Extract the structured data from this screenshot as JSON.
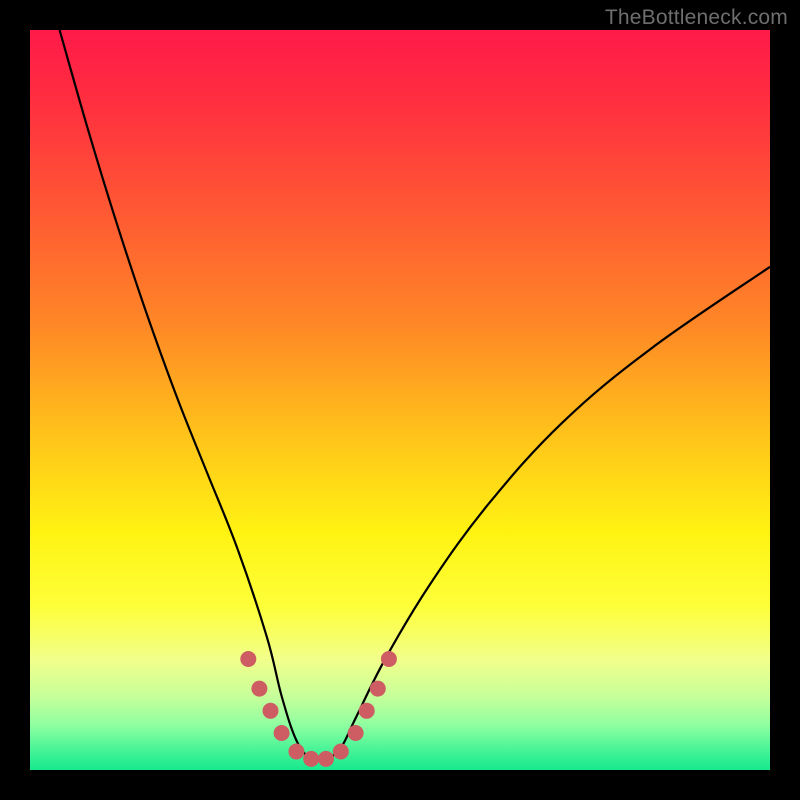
{
  "watermark": "TheBottleneck.com",
  "colors": {
    "black": "#000000",
    "curve": "#000000",
    "marker": "#cd5d63",
    "gradient_stops": [
      {
        "offset": 0.0,
        "color": "#ff1a49"
      },
      {
        "offset": 0.1,
        "color": "#ff2f3f"
      },
      {
        "offset": 0.25,
        "color": "#ff5a33"
      },
      {
        "offset": 0.4,
        "color": "#ff8826"
      },
      {
        "offset": 0.55,
        "color": "#ffc41a"
      },
      {
        "offset": 0.68,
        "color": "#fff312"
      },
      {
        "offset": 0.78,
        "color": "#fdff3a"
      },
      {
        "offset": 0.85,
        "color": "#f2ff8a"
      },
      {
        "offset": 0.9,
        "color": "#c7ff9a"
      },
      {
        "offset": 0.94,
        "color": "#8effa0"
      },
      {
        "offset": 0.97,
        "color": "#4cf598"
      },
      {
        "offset": 1.0,
        "color": "#17e88e"
      }
    ]
  },
  "chart_data": {
    "type": "line",
    "title": "",
    "xlabel": "",
    "ylabel": "",
    "xlim": [
      0,
      100
    ],
    "ylim": [
      0,
      100
    ],
    "note": "V-shaped bottleneck curve. y≈0 is optimal (green), y≈100 is worst (red). Minimum sits near x≈38 with a flat bottom ~x∈[34,44].",
    "series": [
      {
        "name": "bottleneck-curve",
        "x": [
          4,
          8,
          12,
          16,
          20,
          24,
          28,
          32,
          34,
          36,
          38,
          40,
          42,
          44,
          48,
          54,
          62,
          72,
          84,
          100
        ],
        "y": [
          100,
          86,
          73,
          61,
          50,
          40,
          30,
          18,
          10,
          4,
          1.5,
          1.5,
          3,
          7,
          15,
          25,
          36,
          47,
          57,
          68
        ]
      }
    ],
    "highlight_points": {
      "name": "near-optimum-markers",
      "x": [
        29.5,
        31,
        32.5,
        34,
        36,
        38,
        40,
        42,
        44,
        45.5,
        47,
        48.5
      ],
      "y": [
        15,
        11,
        8,
        5,
        2.5,
        1.5,
        1.5,
        2.5,
        5,
        8,
        11,
        15
      ]
    }
  }
}
